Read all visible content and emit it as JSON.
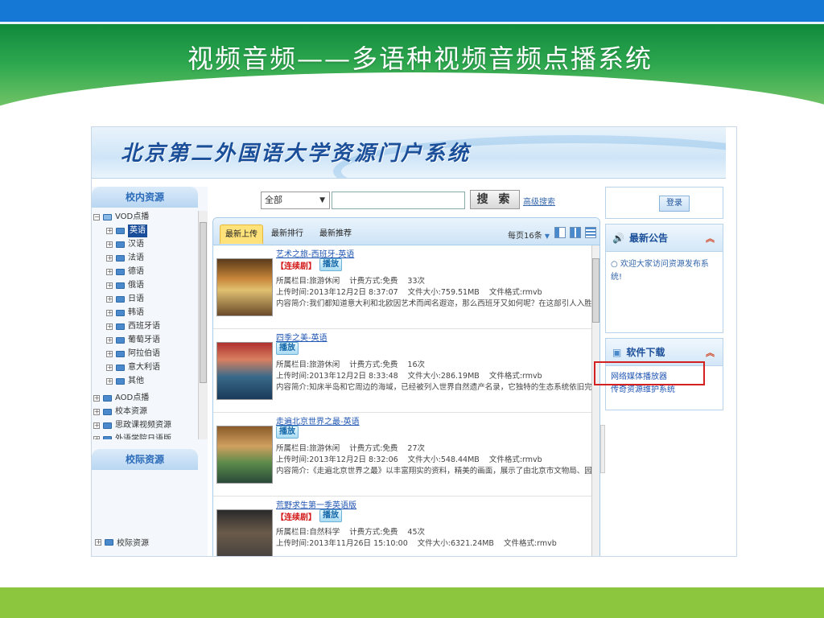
{
  "slide": {
    "title": "视频音频——多语种视频音频点播系统"
  },
  "banner": {
    "title": "北京第二外国语大学资源门户系统"
  },
  "left": {
    "section1": "校内资源",
    "section2": "校际资源",
    "tree_root": "VOD点播",
    "languages": [
      "英语",
      "汉语",
      "法语",
      "德语",
      "俄语",
      "日语",
      "韩语",
      "西班牙语",
      "葡萄牙语",
      "阿拉伯语",
      "意大利语",
      "其他"
    ],
    "more_nodes": [
      "AOD点播",
      "校本资源",
      "思政课视频资源",
      "外语学院日语版..."
    ],
    "campus_node": "校际资源"
  },
  "search": {
    "select_value": "全部",
    "button": "搜 索",
    "advanced": "高级搜索"
  },
  "tabs": {
    "latest": "最新上传",
    "ranking": "最新排行",
    "recommend": "最新推荐",
    "per_page": "每页16条"
  },
  "labels": {
    "serial": "【连续剧】",
    "play": "播放"
  },
  "items": [
    {
      "title": "艺术之旅-西班牙-英语",
      "category": "所属栏目:旅游休闲",
      "billing": "计费方式:免费",
      "plays": "33次",
      "uploaded": "上传时间:2013年12月2日 8:37:07",
      "size": "文件大小:759.51MB",
      "format": "文件格式:rmvb",
      "intro": "内容简介:我们都知道意大利和北欧因艺术而闻名遐迩，那么西班牙又如何呢？在这部引人入胜"
    },
    {
      "title": "四季之美-英语",
      "category": "所属栏目:旅游休闲",
      "billing": "计费方式:免费",
      "plays": "16次",
      "uploaded": "上传时间:2013年12月2日 8:33:48",
      "size": "文件大小:286.19MB",
      "format": "文件格式:rmvb",
      "intro": "内容简介:知床半岛和它周边的海域，已经被列入世界自然遗产名录，它独特的生态系统依旧完好"
    },
    {
      "title": "走遍北京世界之最-英语",
      "category": "所属栏目:旅游休闲",
      "billing": "计费方式:免费",
      "plays": "27次",
      "uploaded": "上传时间:2013年12月2日 8:32:06",
      "size": "文件大小:548.44MB",
      "format": "文件格式:rmvb",
      "intro": "内容简介:《走遍北京世界之最》以丰富翔实的资料，精美的画面，展示了由北京市文物局、园林"
    },
    {
      "title": "荒野求生第一季英语版",
      "category": "所属栏目:自然科学",
      "billing": "计费方式:免费",
      "plays": "45次",
      "uploaded": "上传时间:2013年11月26日 15:10:00",
      "size": "文件大小:6321.24MB",
      "format": "文件格式:rmvb",
      "intro": ""
    }
  ],
  "right": {
    "login": "登录",
    "notice_title": "最新公告",
    "notice_text": "欢迎大家访问资源发布系统!",
    "download_title": "软件下载",
    "downloads": [
      "网络媒体播放器",
      "传奇资源维护系统"
    ]
  },
  "colors": {
    "accent_blue": "#1478d4",
    "header_green": "#2ea84f",
    "footer_green": "#8cc63f",
    "highlight_red": "#d42020"
  }
}
